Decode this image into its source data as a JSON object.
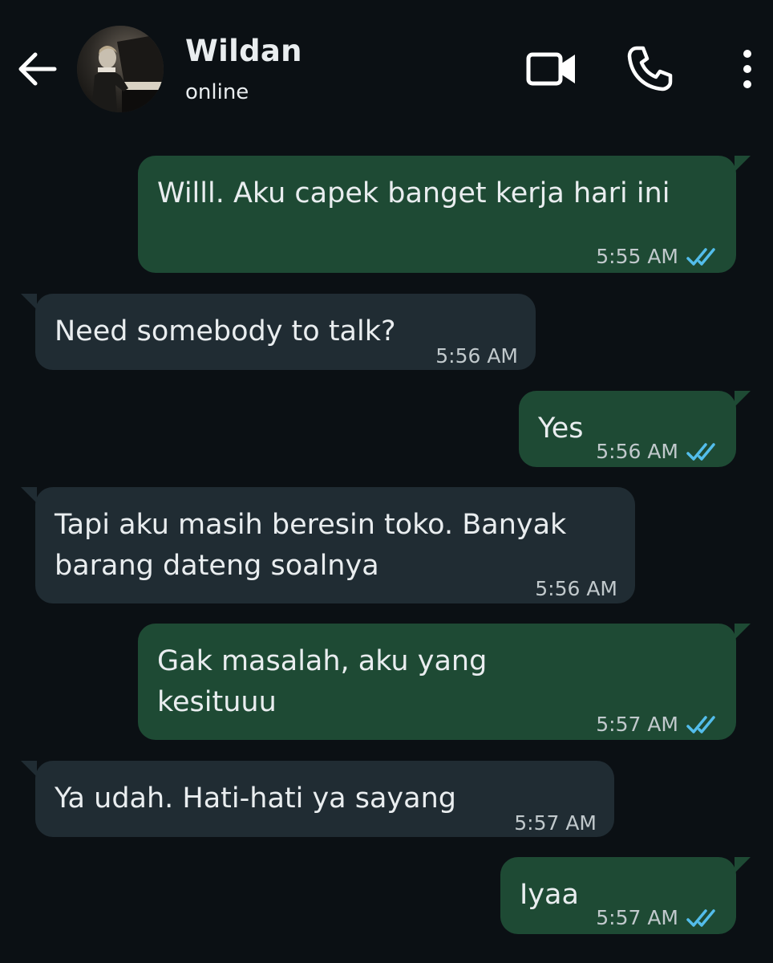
{
  "header": {
    "contact_name": "Wildan",
    "status": "online"
  },
  "colors": {
    "background": "#0b1014",
    "outgoing_bubble": "#1e4a34",
    "incoming_bubble": "#202c33",
    "read_ticks": "#53bdeb",
    "timestamp": "#c1c9cc"
  },
  "icons": {
    "back": "arrow-left",
    "video": "video-camera",
    "call": "phone",
    "menu": "vertical-dots"
  },
  "messages": [
    {
      "direction": "outgoing",
      "text": "Willl. Aku capek banget kerja hari ini",
      "time": "5:55 AM",
      "status": "read"
    },
    {
      "direction": "incoming",
      "text": "Need somebody to talk?",
      "time": "5:56 AM"
    },
    {
      "direction": "outgoing",
      "text": "Yes",
      "time": "5:56 AM",
      "status": "read"
    },
    {
      "direction": "incoming",
      "text": "Tapi aku masih beresin toko. Banyak barang dateng soalnya",
      "time": "5:56 AM"
    },
    {
      "direction": "outgoing",
      "text": "Gak masalah, aku yang kesituuu",
      "time": "5:57 AM",
      "status": "read"
    },
    {
      "direction": "incoming",
      "text": "Ya udah. Hati-hati ya sayang",
      "time": "5:57 AM"
    },
    {
      "direction": "outgoing",
      "text": "Iyaa",
      "time": "5:57 AM",
      "status": "read"
    }
  ]
}
